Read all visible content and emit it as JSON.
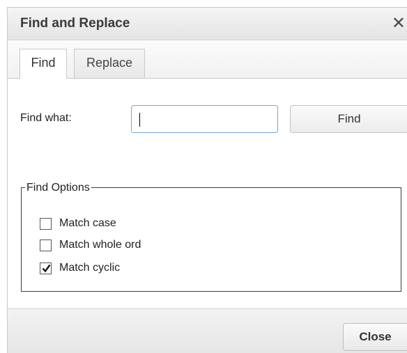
{
  "dialog": {
    "title": "Find and Replace",
    "close_glyph": "✕",
    "close_icon": "close-icon"
  },
  "tabs": [
    {
      "label": "Find",
      "active": true
    },
    {
      "label": "Replace",
      "active": false
    }
  ],
  "find": {
    "label": "Find what:",
    "input_value": "",
    "button_label": "Find"
  },
  "options": {
    "legend": "Find Options",
    "items": [
      {
        "label": "Match case",
        "checked": false
      },
      {
        "label": "Match whole ord",
        "checked": false
      },
      {
        "label": "Match cyclic",
        "checked": true
      }
    ]
  },
  "footer": {
    "close_label": "Close"
  }
}
